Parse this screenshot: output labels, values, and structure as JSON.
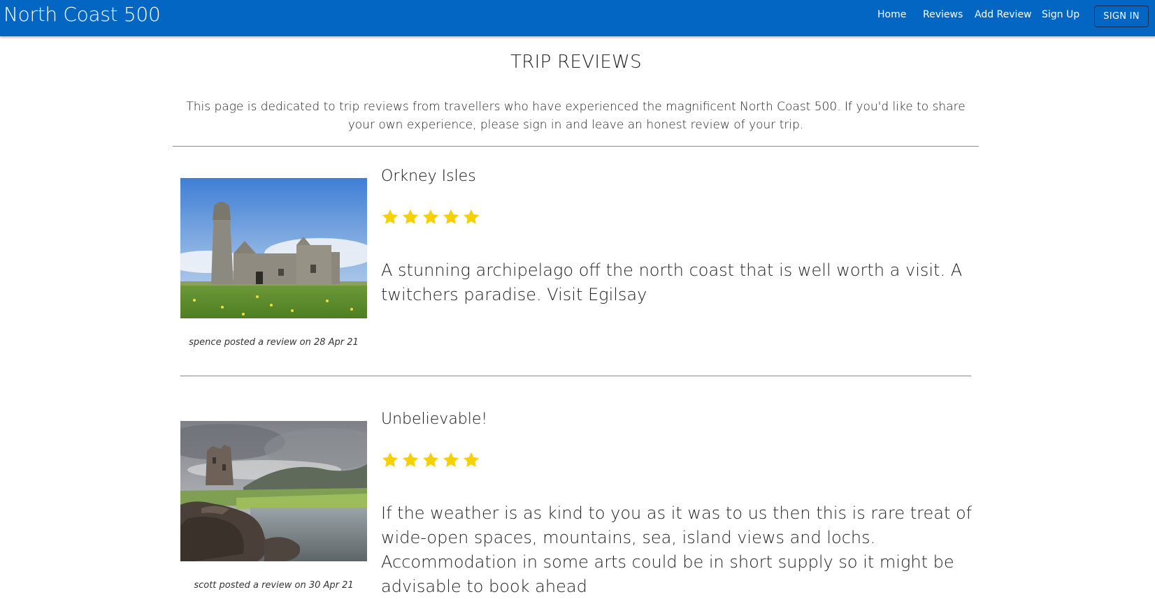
{
  "navbar": {
    "brand": "North Coast 500",
    "links": [
      "Home",
      "Reviews",
      "Add Review",
      "Sign Up"
    ],
    "signin_label": "SIGN IN",
    "colors": {
      "background": "#0366c3",
      "text": "#ffffff"
    }
  },
  "page": {
    "title": "TRIP REVIEWS",
    "intro": "This page is dedicated to trip reviews from travellers who have experienced the magnificent North Coast 500. If you'd like to share your own experience, please sign in and leave an honest review of your trip."
  },
  "reviews": [
    {
      "image_icon": "orkney-ruin-photo",
      "title": "Orkney Isles",
      "rating": 5,
      "rating_max": 5,
      "text": "A stunning archipelago off the north coast that is well worth a visit. A twitchers paradise. Visit Egilsay",
      "caption": "spence posted a review on 28 Apr 21"
    },
    {
      "image_icon": "castle-loch-photo",
      "title": "Unbelievable!",
      "rating": 5,
      "rating_max": 5,
      "text": "If the weather is as kind to you as it was to us then this is rare treat of wide-open spaces, mountains, sea, island views and lochs. Accommodation in some arts could be in short supply so it might be advisable to book ahead",
      "caption": "scott posted a review on 30 Apr 21"
    }
  ],
  "colors": {
    "star": "#f7d000",
    "divider": "#8a8a8a"
  }
}
